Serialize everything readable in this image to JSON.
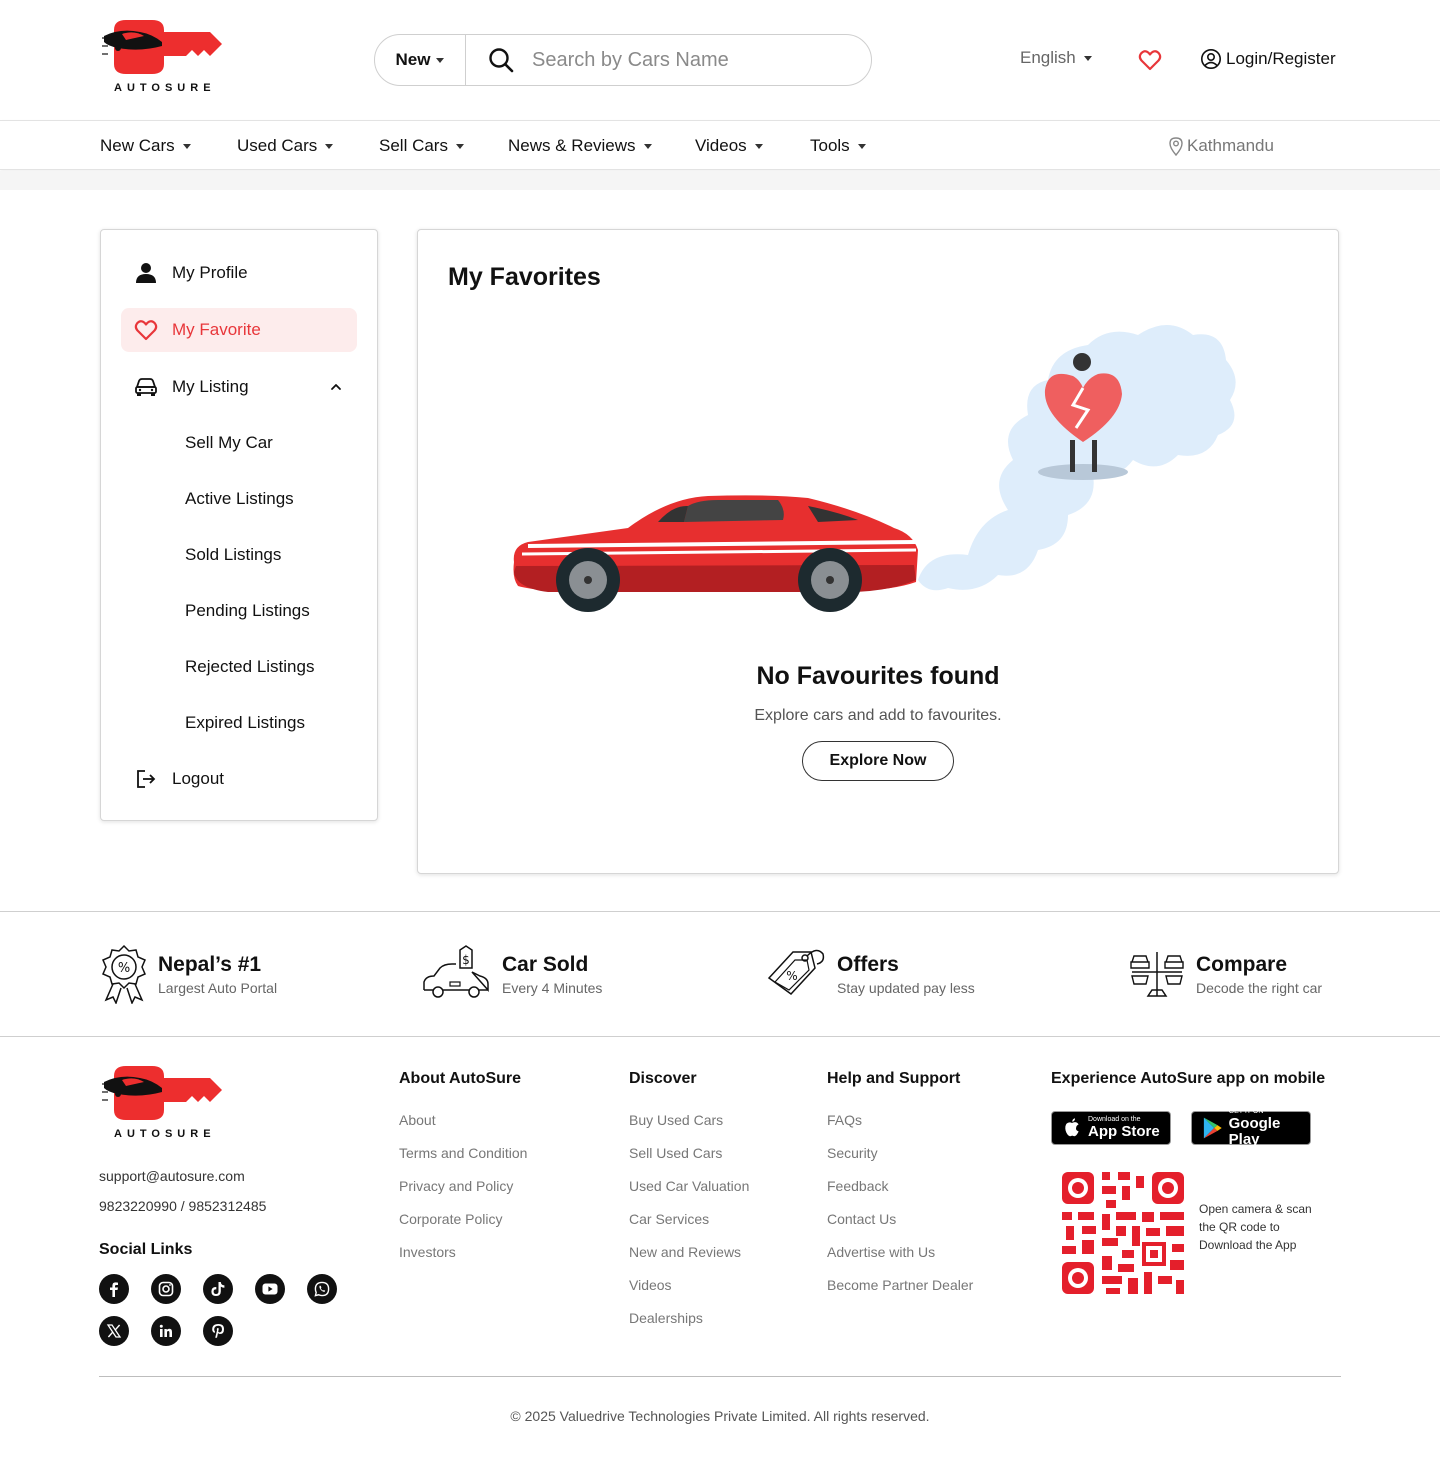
{
  "brand": {
    "logo_text": "AUTOSURE",
    "accent": "#e8363a"
  },
  "header": {
    "search_type": "New",
    "search_placeholder": "Search by Cars Name",
    "language": "English",
    "login_label": "Login/Register"
  },
  "nav": {
    "items": [
      "New Cars",
      "Used Cars",
      "Sell Cars",
      "News & Reviews",
      "Videos",
      "Tools"
    ],
    "location": "Kathmandu"
  },
  "sidebar": {
    "profile": "My Profile",
    "favorite": "My Favorite",
    "listing": "My Listing",
    "sub_items": [
      "Sell My Car",
      "Active Listings",
      "Sold Listings",
      "Pending Listings",
      "Rejected Listings",
      "Expired Listings"
    ],
    "logout": "Logout"
  },
  "main": {
    "title": "My Favorites",
    "empty_title": "No Favourites found",
    "empty_subtitle": "Explore cars and add to favourites.",
    "explore_button": "Explore Now"
  },
  "features": [
    {
      "title": "Nepal’s #1",
      "subtitle": "Largest Auto Portal",
      "icon": "badge-percent-icon"
    },
    {
      "title": "Car Sold",
      "subtitle": "Every 4 Minutes",
      "icon": "car-price-tag-icon"
    },
    {
      "title": "Offers",
      "subtitle": "Stay updated pay less",
      "icon": "offer-tag-icon"
    },
    {
      "title": "Compare",
      "subtitle": "Decode the right car",
      "icon": "compare-scale-icon"
    }
  ],
  "footer": {
    "email": "support@autosure.com",
    "phones": "9823220990 / 9852312485",
    "social_title": "Social Links",
    "social": [
      "facebook-icon",
      "instagram-icon",
      "tiktok-icon",
      "youtube-icon",
      "whatsapp-icon",
      "x-icon",
      "linkedin-icon",
      "pinterest-icon"
    ],
    "columns": [
      {
        "title": "About AutoSure",
        "links": [
          "About",
          "Terms and Condition",
          "Privacy and Policy",
          "Corporate Policy",
          "Investors"
        ]
      },
      {
        "title": "Discover",
        "links": [
          "Buy Used Cars",
          "Sell Used Cars",
          "Used Car Valuation",
          "Car Services",
          "New and Reviews",
          "Videos",
          "Dealerships"
        ]
      },
      {
        "title": "Help and Support",
        "links": [
          "FAQs",
          "Security",
          "Feedback",
          "Contact Us",
          "Advertise with Us",
          "Become Partner Dealer"
        ]
      }
    ],
    "app": {
      "title": "Experience AutoSure app on mobile",
      "appstore_small": "Download on the",
      "appstore_big": "App Store",
      "play_small": "GET IT ON",
      "play_big": "Google Play",
      "qr_text": "Open camera & scan the QR code to Download the App"
    },
    "copyright": "© 2025 Valuedrive Technologies Private Limited. All rights reserved."
  }
}
